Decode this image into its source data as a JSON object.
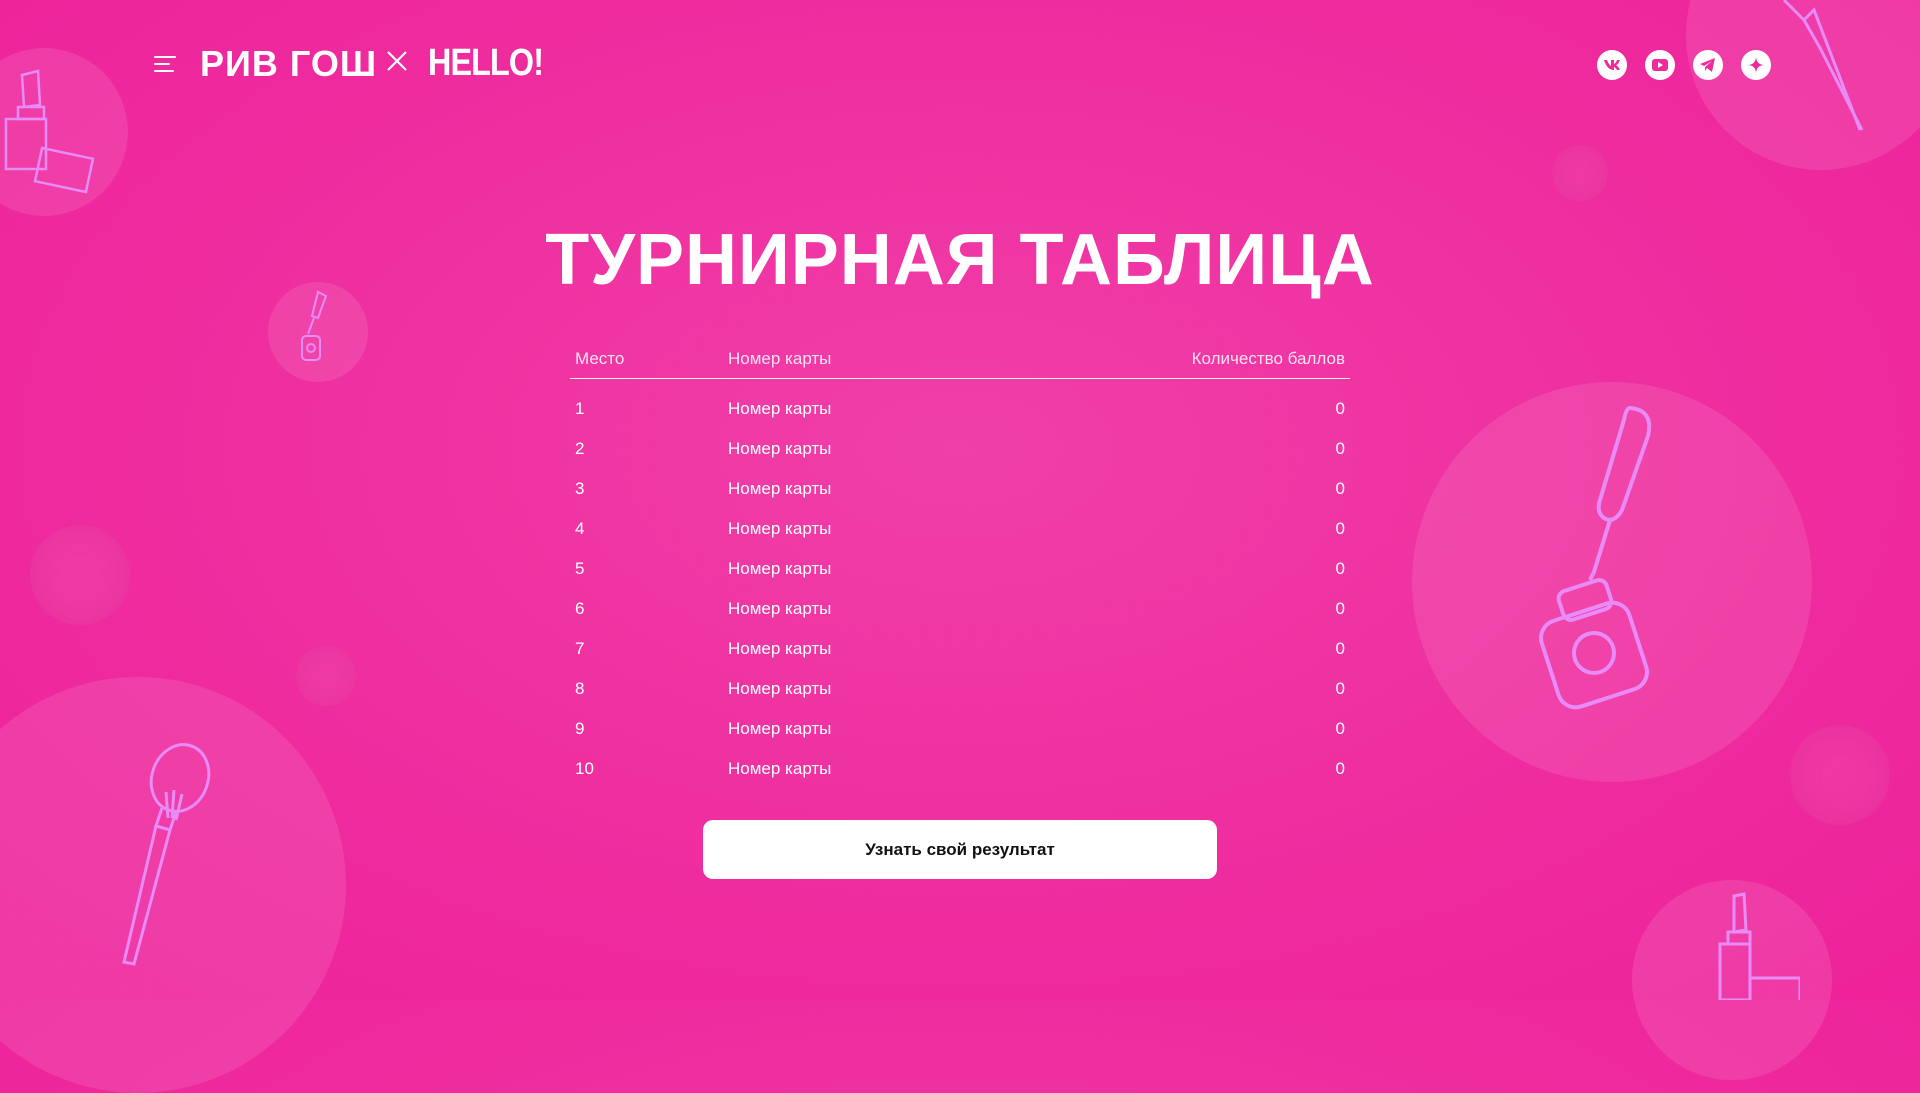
{
  "header": {
    "logo_primary": "РИВ ГОШ",
    "logo_secondary": "HELLO!",
    "social": [
      "vk-icon",
      "youtube-icon",
      "telegram-icon",
      "zen-icon"
    ]
  },
  "title": "ТУРНИРНАЯ ТАБЛИЦА",
  "table": {
    "columns": [
      "Место",
      "Номер карты",
      "Количество баллов"
    ],
    "rows": [
      {
        "place": "1",
        "card": "Номер карты",
        "points": "0"
      },
      {
        "place": "2",
        "card": "Номер карты",
        "points": "0"
      },
      {
        "place": "3",
        "card": "Номер карты",
        "points": "0"
      },
      {
        "place": "4",
        "card": "Номер карты",
        "points": "0"
      },
      {
        "place": "5",
        "card": "Номер карты",
        "points": "0"
      },
      {
        "place": "6",
        "card": "Номер карты",
        "points": "0"
      },
      {
        "place": "7",
        "card": "Номер карты",
        "points": "0"
      },
      {
        "place": "8",
        "card": "Номер карты",
        "points": "0"
      },
      {
        "place": "9",
        "card": "Номер карты",
        "points": "0"
      },
      {
        "place": "10",
        "card": "Номер карты",
        "points": "0"
      }
    ]
  },
  "cta_label": "Узнать свой результат",
  "colors": {
    "background": "#ee2a9d",
    "bubble": "#f355b3",
    "decor_line": "#e88bf7",
    "button": "#ffffff"
  }
}
